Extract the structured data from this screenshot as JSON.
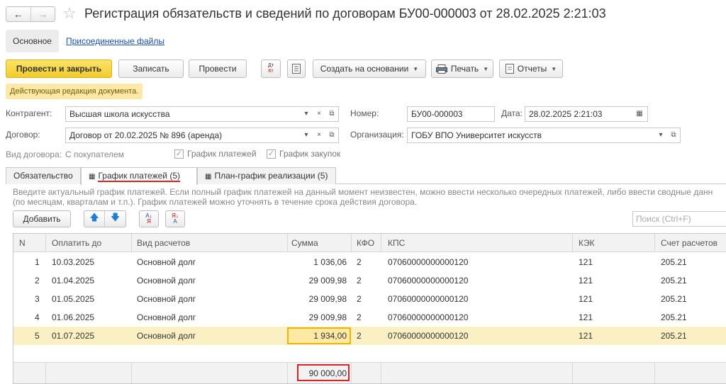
{
  "window": {
    "title": "Регистрация обязательств и сведений по договорам БУ00-000003 от 28.02.2025 2:21:03"
  },
  "nav": {
    "back": "←",
    "forward": "→",
    "star": "☆",
    "main": "Основное",
    "attached": "Присоединенные файлы"
  },
  "toolbar": {
    "post_close": "Провести и закрыть",
    "save": "Записать",
    "post": "Провести",
    "dtkt_top": "Дт",
    "dtkt_bottom": "Кт",
    "create_based": "Создать на основании",
    "print": "Печать",
    "reports": "Отчеты"
  },
  "notice": "Действующая редакция документа.",
  "form": {
    "counterparty_label": "Контрагент:",
    "counterparty": "Высшая школа искусства",
    "number_label": "Номер:",
    "number": "БУ00-000003",
    "date_label": "Дата:",
    "date": "28.02.2025  2:21:03",
    "contract_label": "Договор:",
    "contract": "Договор от 20.02.2025 № 896 (аренда)",
    "org_label": "Организация:",
    "org": "ГОБУ ВПО Университет искусств",
    "contract_type_label": "Вид договора:",
    "contract_type": "С покупателем",
    "payment_schedule_chk": "График платежей",
    "purchase_schedule_chk": "График закупок"
  },
  "tabs": [
    {
      "label": "Обязательство"
    },
    {
      "label": "График платежей (5)"
    },
    {
      "label": "План-график реализации (5)"
    }
  ],
  "hint": {
    "line1": "Введите актуальный график платежей. Если полный график платежей на данный момент неизвестен, можно ввести несколько очередных платежей, либо ввести сводные данн",
    "line2": "(по месяцам, кварталам и т.п.). График платежей можно уточнять в течение срока действия договора."
  },
  "table_toolbar": {
    "add": "Добавить",
    "search_placeholder": "Поиск (Ctrl+F)"
  },
  "table": {
    "columns": [
      "N",
      "Оплатить до",
      "Вид расчетов",
      "Сумма",
      "КФО",
      "КПС",
      "КЭК",
      "Счет расчетов"
    ],
    "rows": [
      [
        "1",
        "10.03.2025",
        "Основной долг",
        "1 036,06",
        "2",
        "07060000000000120",
        "121",
        "205.21"
      ],
      [
        "2",
        "01.04.2025",
        "Основной долг",
        "29 009,98",
        "2",
        "07060000000000120",
        "121",
        "205.21"
      ],
      [
        "3",
        "01.05.2025",
        "Основной долг",
        "29 009,98",
        "2",
        "07060000000000120",
        "121",
        "205.21"
      ],
      [
        "4",
        "01.06.2025",
        "Основной долг",
        "29 009,98",
        "2",
        "07060000000000120",
        "121",
        "205.21"
      ],
      [
        "5",
        "01.07.2025",
        "Основной долг",
        "1 934,00",
        "2",
        "07060000000000120",
        "121",
        "205.21"
      ]
    ],
    "total": "90 000,00"
  }
}
